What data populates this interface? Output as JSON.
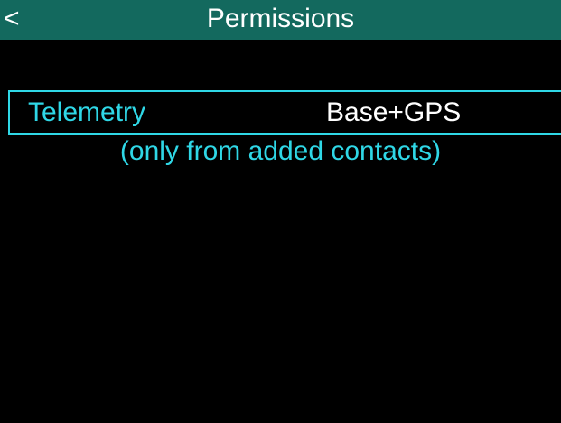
{
  "header": {
    "back_label": "<",
    "title": "Permissions"
  },
  "settings": {
    "items": [
      {
        "label": "Telemetry",
        "value": "Base+GPS",
        "note": "(only from added contacts)"
      }
    ]
  },
  "colors": {
    "header_background": "#13695e",
    "accent": "#2fd7e6",
    "background": "#000000",
    "text": "#ffffff"
  }
}
